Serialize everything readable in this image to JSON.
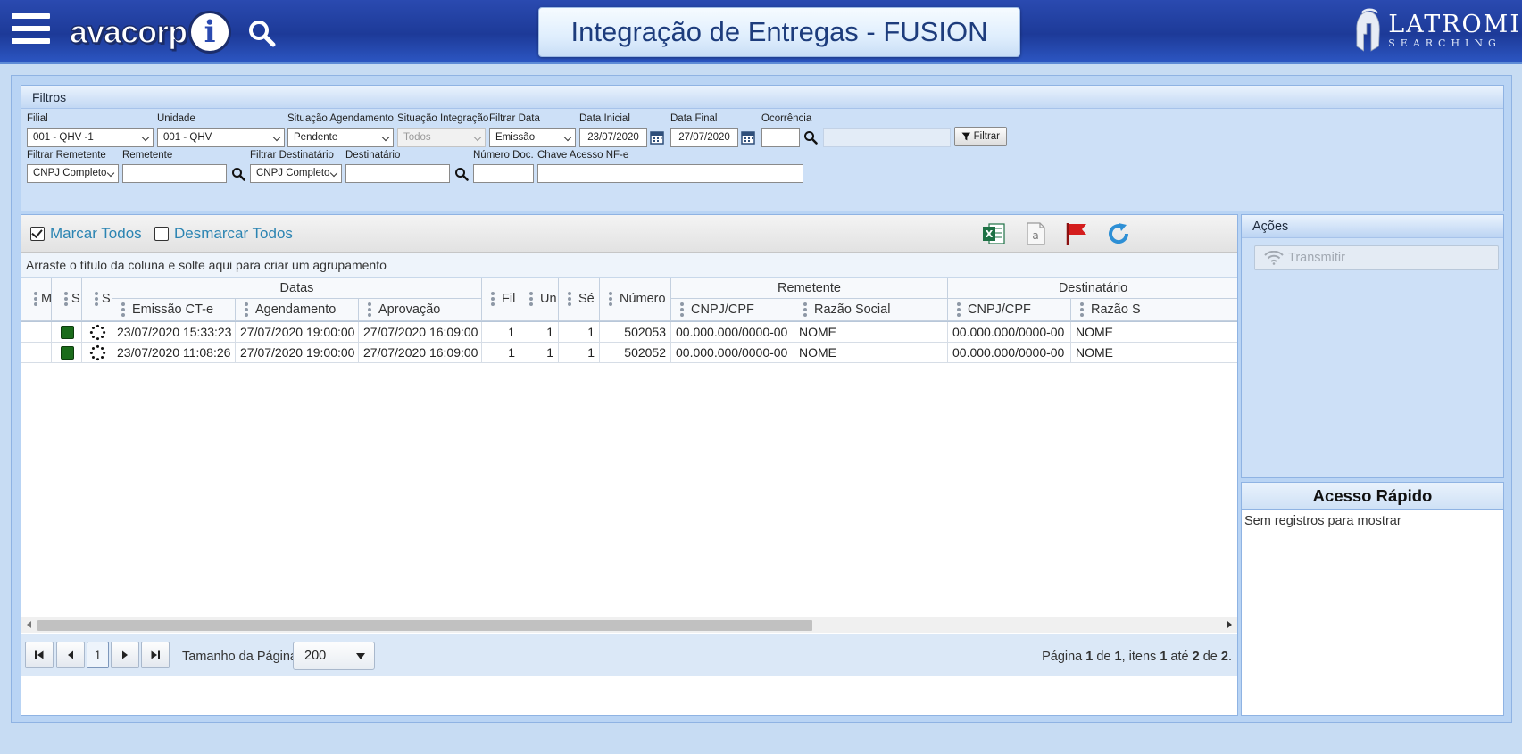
{
  "header": {
    "title": "Integração de Entregas - FUSION",
    "logo_left": "avacorp",
    "logo_right_main": "LATROMI",
    "logo_right_sub": "SEARCHING"
  },
  "filters": {
    "title": "Filtros",
    "filial": {
      "label": "Filial",
      "value": "001 - QHV -1"
    },
    "unidade": {
      "label": "Unidade",
      "value": "001 - QHV"
    },
    "situacao_agendamento": {
      "label": "Situação Agendamento",
      "value": "Pendente"
    },
    "situacao_integracao": {
      "label": "Situação Integração",
      "value": "Todos"
    },
    "filtrar_data": {
      "label": "Filtrar Data",
      "value": "Emissão"
    },
    "data_inicial": {
      "label": "Data Inicial",
      "value": "23/07/2020"
    },
    "data_final": {
      "label": "Data Final",
      "value": "27/07/2020"
    },
    "ocorrencia": {
      "label": "Ocorrência",
      "value": ""
    },
    "filtrar_button": "Filtrar",
    "filtrar_remetente": {
      "label": "Filtrar Remetente",
      "value": "CNPJ Completo"
    },
    "remetente": {
      "label": "Remetente",
      "value": ""
    },
    "filtrar_destinatario": {
      "label": "Filtrar Destinatário",
      "value": "CNPJ Completo"
    },
    "destinatario": {
      "label": "Destinatário",
      "value": ""
    },
    "numero_doc": {
      "label": "Número Doc.",
      "value": ""
    },
    "chave_acesso": {
      "label": "Chave Acesso NF-e",
      "value": ""
    }
  },
  "grid": {
    "marcar_todos": "Marcar Todos",
    "desmarcar_todos": "Desmarcar Todos",
    "group_hint": "Arraste o título da coluna e solte aqui para criar um agrupamento",
    "group_headers": {
      "datas": "Datas",
      "remetente": "Remetente",
      "destinatario": "Destinatário"
    },
    "columns": {
      "m": "M",
      "s1": "S",
      "s2": "S",
      "emissao": "Emissão CT-e",
      "agendamento": "Agendamento",
      "aprovacao": "Aprovação",
      "filial": "Fil",
      "unidade": "Un",
      "serie": "Sé",
      "numero": "Número",
      "rem_cnpj": "CNPJ/CPF",
      "rem_razao": "Razão Social",
      "dest_cnpj": "CNPJ/CPF",
      "dest_razao": "Razão S"
    },
    "rows": [
      {
        "emissao": "23/07/2020 15:33:23",
        "agendamento": "27/07/2020 19:00:00",
        "aprovacao": "27/07/2020 16:09:00",
        "filial": "1",
        "unidade": "1",
        "serie": "1",
        "numero": "502053",
        "rem_cnpj": "00.000.000/0000-00",
        "rem_razao": "NOME",
        "dest_cnpj": "00.000.000/0000-00",
        "dest_razao": "NOME"
      },
      {
        "emissao": "23/07/2020 11:08:26",
        "agendamento": "27/07/2020 19:00:00",
        "aprovacao": "27/07/2020 16:09:00",
        "filial": "1",
        "unidade": "1",
        "serie": "1",
        "numero": "502052",
        "rem_cnpj": "00.000.000/0000-00",
        "rem_razao": "NOME",
        "dest_cnpj": "00.000.000/0000-00",
        "dest_razao": "NOME"
      }
    ],
    "status_color": "#1a6b1a",
    "pager": {
      "current_page": "1",
      "page_size_label": "Tamanho da Página",
      "page_size": "200",
      "info_prefix": "Página ",
      "info_page": "1",
      "info_de1": " de ",
      "info_total_pages": "1",
      "info_itens": ", itens ",
      "info_from": "1",
      "info_ate": " até ",
      "info_to": "2",
      "info_de2": " de ",
      "info_total": "2",
      "info_end": "."
    }
  },
  "acoes": {
    "title": "Ações",
    "transmitir": "Transmitir"
  },
  "acesso_rapido": {
    "title": "Acesso Rápido",
    "empty": "Sem registros para mostrar"
  },
  "icons": [
    "menu-icon",
    "search-icon",
    "calendar-icon",
    "filter-icon",
    "excel-icon",
    "pdf-icon",
    "flag-icon",
    "refresh-icon",
    "wifi-icon"
  ]
}
